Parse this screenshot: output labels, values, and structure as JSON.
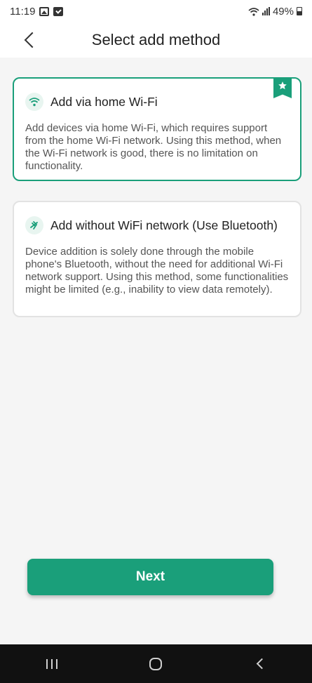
{
  "status_bar": {
    "time": "11:19",
    "battery": "49%"
  },
  "header": {
    "title": "Select add method"
  },
  "methods": [
    {
      "title": "Add via home Wi-Fi",
      "description": "Add devices via home Wi-Fi, which requires support from the home Wi-Fi network. Using this method, when the Wi-Fi network is good, there is no limitation on functionality.",
      "icon": "wifi-icon",
      "selected": true
    },
    {
      "title": "Add without WiFi network (Use Bluetooth)",
      "description": "Device addition is solely done through the mobile phone's Bluetooth, without the need for additional Wi-Fi network support. Using this method, some functionalities might be limited (e.g., inability to view data remotely).",
      "icon": "bluetooth-icon",
      "selected": false
    }
  ],
  "next_button": {
    "label": "Next"
  },
  "colors": {
    "accent": "#1a9f7a",
    "background": "#f5f5f5",
    "nav_bar": "#111111"
  }
}
